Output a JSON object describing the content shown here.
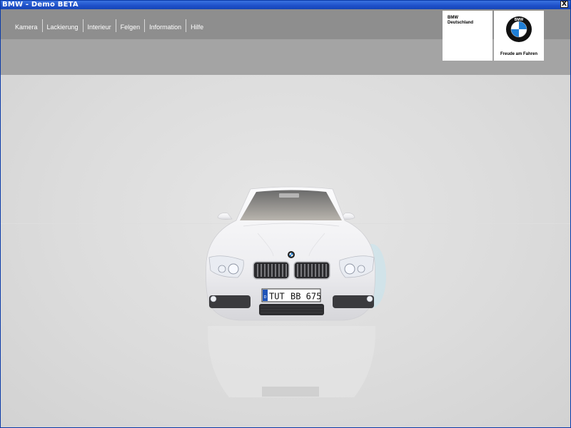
{
  "window": {
    "title": "BMW - Demo BETA",
    "close_glyph": "X"
  },
  "menu": {
    "items": [
      {
        "label": "Kamera"
      },
      {
        "label": "Lackierung"
      },
      {
        "label": "Interieur"
      },
      {
        "label": "Felgen"
      },
      {
        "label": "Information"
      },
      {
        "label": "Hilfe"
      }
    ]
  },
  "branding": {
    "line1": "BMW",
    "line2": "Deutschland",
    "logo_letters": "BMW",
    "slogan": "Freude am Fahren"
  },
  "car": {
    "plate_country": "D",
    "plate_text_left": "TUT",
    "plate_text_right": "BB 675",
    "paint_color": "#f2f2f4"
  },
  "colors": {
    "titlebar": "#1d4fc8",
    "toolbar": "#8e8e8e",
    "subbar": "#a4a4a4",
    "stage": "#dcdcdc",
    "logo_blue": "#1f7fd6"
  }
}
